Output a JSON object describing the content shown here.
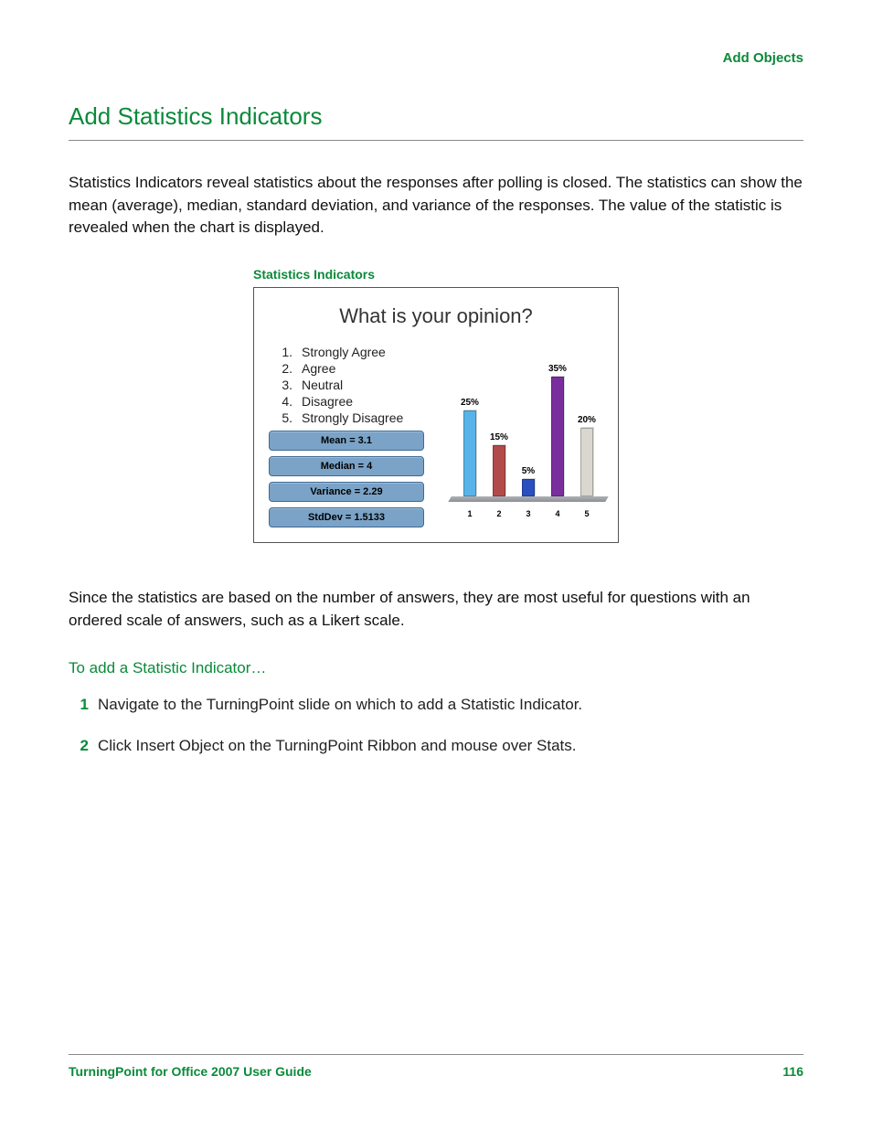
{
  "breadcrumb": "Add Objects",
  "section_title": "Add Statistics Indicators",
  "intro": "Statistics Indicators reveal statistics about the responses after polling is closed. The statistics can show the mean (average), median, standard deviation, and variance of the responses. The value of the statistic is revealed when the chart is displayed.",
  "figure": {
    "caption": "Statistics Indicators",
    "title": "What is your opinion?",
    "answers": [
      {
        "n": "1.",
        "t": "Strongly Agree"
      },
      {
        "n": "2.",
        "t": "Agree"
      },
      {
        "n": "3.",
        "t": "Neutral"
      },
      {
        "n": "4.",
        "t": "Disagree"
      },
      {
        "n": "5.",
        "t": "Strongly Disagree"
      }
    ],
    "stats": [
      "Mean = 3.1",
      "Median = 4",
      "Variance = 2.29",
      "StdDev = 1.5133"
    ]
  },
  "chart_data": {
    "type": "bar",
    "title": "What is your opinion?",
    "categories": [
      "1",
      "2",
      "3",
      "4",
      "5"
    ],
    "values": [
      25,
      15,
      5,
      35,
      20
    ],
    "value_labels": [
      "25%",
      "15%",
      "5%",
      "35%",
      "20%"
    ],
    "colors": [
      "#58b4e8",
      "#b24a4a",
      "#2a4fbf",
      "#7a2e9e",
      "#d9d7cf"
    ],
    "xlabel": "",
    "ylabel": "",
    "ylim": [
      0,
      40
    ]
  },
  "para2": "Since the statistics are based on the number of answers, they are most useful for questions with an ordered scale of answers, such as a Likert scale.",
  "sub_heading": "To add a Statistic Indicator…",
  "steps": [
    {
      "n": "1",
      "t": "Navigate to the TurningPoint slide on which to add a Statistic Indicator."
    },
    {
      "n": "2",
      "t": "Click Insert Object on the TurningPoint Ribbon and mouse over Stats."
    }
  ],
  "footer": {
    "left": "TurningPoint for Office 2007 User Guide",
    "right": "116"
  }
}
